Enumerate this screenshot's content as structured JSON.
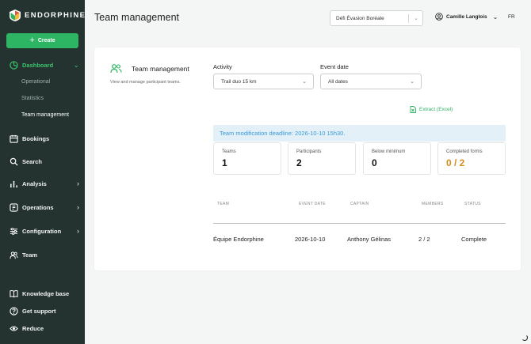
{
  "app": {
    "brand": "ENDORPHINE",
    "accent": "#2db563",
    "sidebar_bg": "#24332f"
  },
  "sidebar": {
    "create_label": "Create",
    "dashboard": {
      "label": "Dashboard",
      "icon": "dashboard-icon"
    },
    "sub_items": [
      {
        "label": "Operational"
      },
      {
        "label": "Statistics"
      },
      {
        "label": "Team management"
      }
    ],
    "items": [
      {
        "label": "Bookings",
        "icon": "calendar-icon"
      },
      {
        "label": "Search",
        "icon": "search-icon"
      },
      {
        "label": "Analysis",
        "icon": "bar-chart-icon"
      },
      {
        "label": "Operations",
        "icon": "operations-icon"
      },
      {
        "label": "Configuration",
        "icon": "sliders-icon"
      },
      {
        "label": "Team",
        "icon": "team-icon"
      }
    ],
    "bottom": [
      {
        "label": "Knowledge base",
        "icon": "book-icon"
      },
      {
        "label": "Get support",
        "icon": "help-icon"
      },
      {
        "label": "Reduce",
        "icon": "eye-icon"
      }
    ]
  },
  "header": {
    "title": "Team management",
    "event_select": "Défi Évasion Boréale",
    "user": "Camille Langlois",
    "lang": "FR"
  },
  "card": {
    "title": "Team management",
    "description": "View and manage participant teams.",
    "activity_label": "Activity",
    "activity_value": "Trail duo 15 km",
    "date_label": "Event date",
    "date_value": "All dates",
    "extract_label": "Extract (Excel)",
    "deadline": "Team modification deadline: 2026-10-10 15h30.",
    "stats": [
      {
        "label": "Teams",
        "value": "1"
      },
      {
        "label": "Participants",
        "value": "2"
      },
      {
        "label": "Below minimum",
        "value": "0"
      },
      {
        "label": "Completed forms",
        "value": "0 / 2"
      }
    ],
    "table": {
      "headers": [
        "TEAM",
        "EVENT DATE",
        "CAPTAIN",
        "MEMBERS",
        "STATUS"
      ],
      "rows": [
        [
          "Équipe Endorphine",
          "2026-10-10",
          "Anthony Gélinas",
          "2 / 2",
          "Complete"
        ]
      ]
    }
  }
}
